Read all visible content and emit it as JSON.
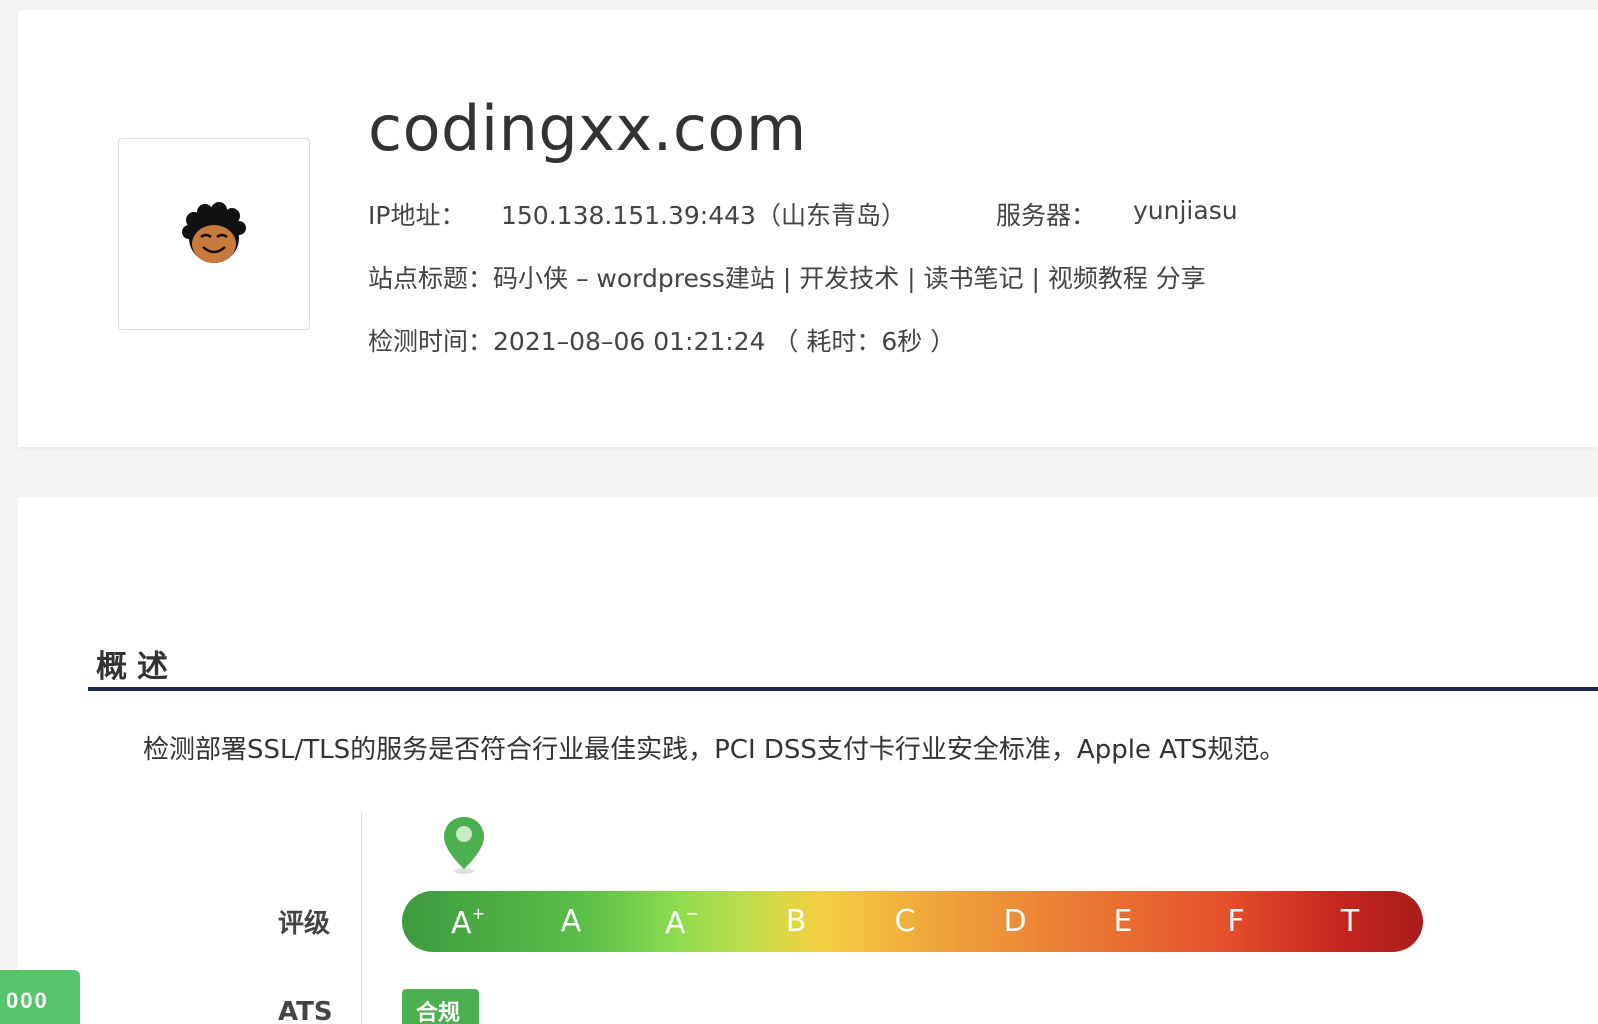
{
  "site": {
    "domain": "codingxx.com",
    "ip_label": "IP地址：",
    "ip_value": "150.138.151.39:443（山东青岛）",
    "server_label": "服务器：",
    "server_value": "yunjiasu",
    "title_label": "站点标题：",
    "title_value": "码小侠 – wordpress建站 | 开发技术 | 读书笔记 | 视频教程 分享",
    "time_label": "检测时间：",
    "time_value": "2021–08–06 01:21:24 （ 耗时：6秒 ）",
    "logo_icon": "avatar-face-icon"
  },
  "overview": {
    "title": "概述",
    "description": "检测部署SSL/TLS的服务是否符合行业最佳实践，PCI DSS支付卡行业安全标准，Apple ATS规范。",
    "rating_label": "评级",
    "current_grade": "A+",
    "grades": [
      "A+",
      "A",
      "A-",
      "B",
      "C",
      "D",
      "E",
      "F",
      "T"
    ],
    "ats_label": "ATS",
    "ats_badge": "合规",
    "colors": {
      "bar_start": "#3c9b3e",
      "bar_mid": "#f5cf42",
      "bar_end": "#a81d1b",
      "pin": "#4caf50",
      "divider": "#1f2a4a"
    }
  },
  "float_button": {
    "label": "000"
  }
}
